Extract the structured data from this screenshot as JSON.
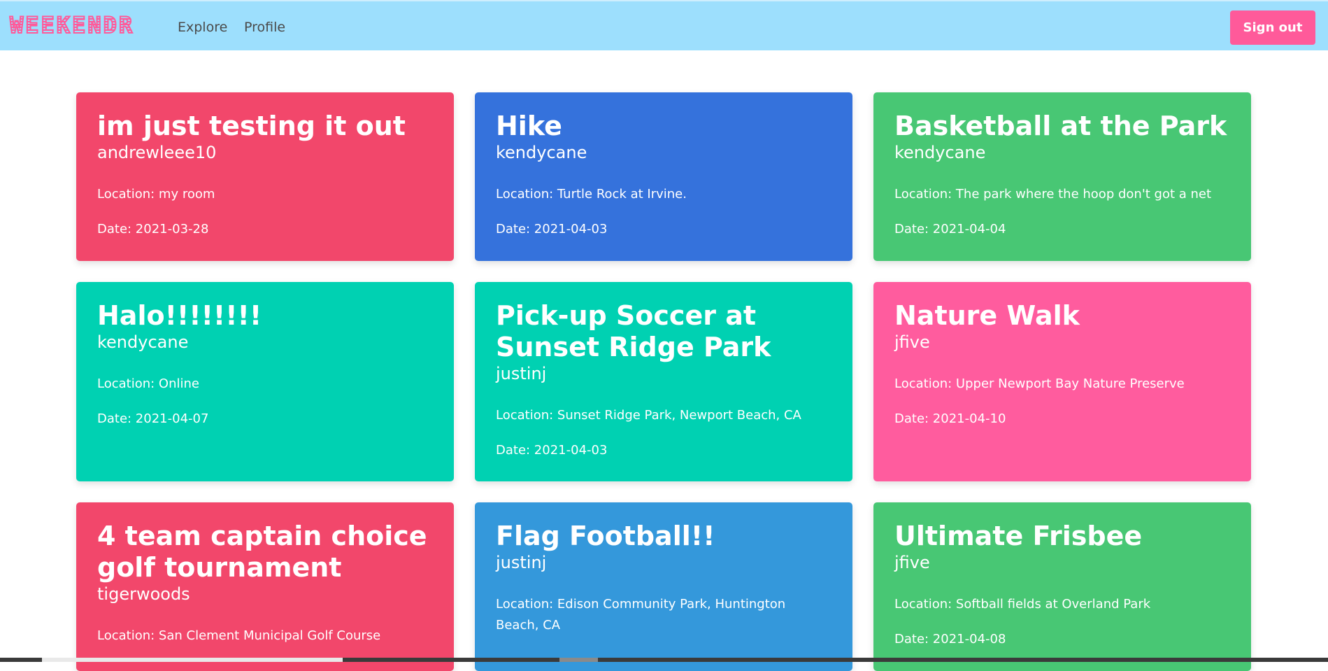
{
  "nav": {
    "logo": "WEEKENDR",
    "links": [
      "Explore",
      "Profile"
    ],
    "signout_label": "Sign out"
  },
  "colors": {
    "navbar": "#9ddffd",
    "accent": "#ff5a9a",
    "red": "#f2476b",
    "blue": "#3572dc",
    "green": "#48c774",
    "teal": "#00d1b2",
    "pink": "#ff5c9e",
    "lightblue": "#3498db"
  },
  "events": [
    {
      "title": "im just testing it out",
      "user": "andrewleee10",
      "location": "Location: my room",
      "date": "Date: 2021-03-28",
      "color": "#f2476b"
    },
    {
      "title": "Hike",
      "user": "kendycane",
      "location": "Location: Turtle Rock at Irvine.",
      "date": "Date: 2021-04-03",
      "color": "#3572dc"
    },
    {
      "title": "Basketball at the Park",
      "user": "kendycane",
      "location": "Location: The park where the hoop don't got a net",
      "date": "Date: 2021-04-04",
      "color": "#48c774"
    },
    {
      "title": "Halo!!!!!!!!",
      "user": "kendycane",
      "location": "Location: Online",
      "date": "Date: 2021-04-07",
      "color": "#00d1b2"
    },
    {
      "title": "Pick-up Soccer at Sunset Ridge Park",
      "user": "justinj",
      "location": "Location: Sunset Ridge Park, Newport Beach, CA",
      "date": "Date: 2021-04-03",
      "color": "#00d1b2"
    },
    {
      "title": "Nature Walk",
      "user": "jfive",
      "location": "Location: Upper Newport Bay Nature Preserve",
      "date": "Date: 2021-04-10",
      "color": "#ff5c9e"
    },
    {
      "title": "4 team captain choice golf tournament",
      "user": "tigerwoods",
      "location": "Location: San Clement Municipal Golf Course",
      "date": "",
      "color": "#f2476b"
    },
    {
      "title": "Flag Football!!",
      "user": "justinj",
      "location": "Location: Edison Community Park, Huntington Beach, CA",
      "date": "",
      "color": "#3498db"
    },
    {
      "title": "Ultimate Frisbee",
      "user": "jfive",
      "location": "Location: Softball fields at Overland Park",
      "date": "Date: 2021-04-08",
      "color": "#48c774"
    }
  ]
}
